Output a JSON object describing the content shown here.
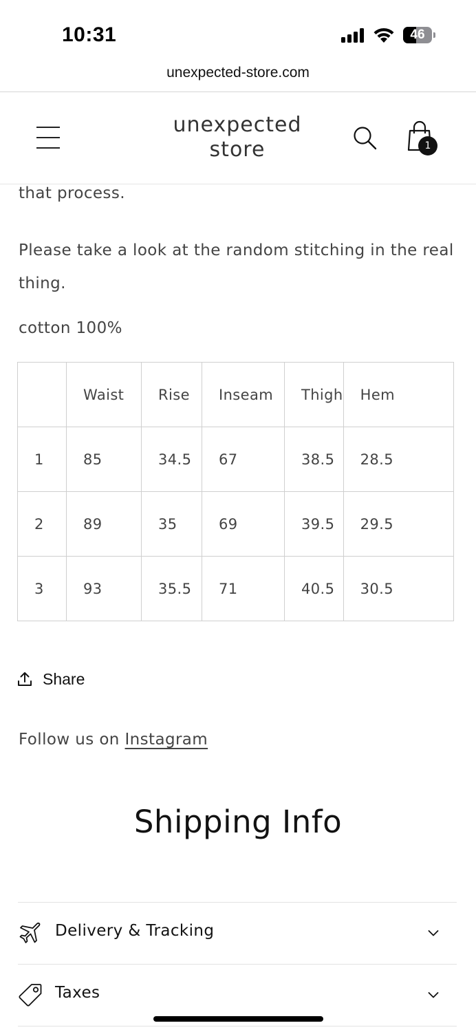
{
  "status_bar": {
    "time": "10:31",
    "battery_level": "46",
    "battery_fraction": 0.46
  },
  "browser": {
    "url": "unexpected-store.com"
  },
  "header": {
    "logo_line1": "unexpected",
    "logo_line2": "store",
    "cart_count": "1",
    "icons": [
      "menu-icon",
      "search-icon",
      "shopping-bag-icon"
    ]
  },
  "description": {
    "line1": "that process.",
    "paragraph2": "Please take a look at the random stitching in the real thing.",
    "material": "cotton 100%"
  },
  "size_table": {
    "headers": [
      "",
      "Waist",
      "Rise",
      "Inseam",
      "Thigh",
      "Hem"
    ],
    "rows": [
      [
        "1",
        "85",
        "34.5",
        "67",
        "38.5",
        "28.5"
      ],
      [
        "2",
        "89",
        "35",
        "69",
        "39.5",
        "29.5"
      ],
      [
        "3",
        "93",
        "35.5",
        "71",
        "40.5",
        "30.5"
      ]
    ]
  },
  "share": {
    "label": "Share"
  },
  "follow": {
    "prefix": "Follow us on ",
    "link": "Instagram"
  },
  "shipping": {
    "heading": "Shipping Info",
    "items": [
      {
        "label": "Delivery & Tracking",
        "icon": "airplane-icon"
      },
      {
        "label": "Taxes",
        "icon": "price-tag-icon"
      }
    ]
  }
}
